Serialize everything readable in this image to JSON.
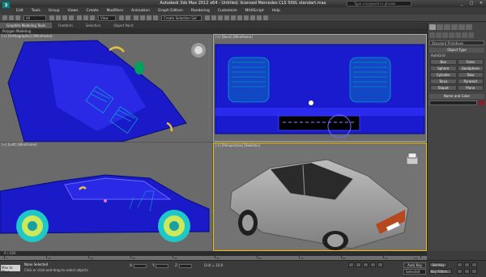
{
  "app": {
    "logo_text": "3",
    "title": "Autodesk 3ds Max 2012 x64  -  Untitled, licensed   Mercedes CLS 500L standart.max",
    "search_placeholder": "Type a keyword or phrase",
    "win_buttons": [
      "_",
      "□",
      "✕"
    ]
  },
  "menu": [
    "Edit",
    "Tools",
    "Group",
    "Views",
    "Create",
    "Modifiers",
    "Animation",
    "Graph Editors",
    "Rendering",
    "Customize",
    "MAXScript",
    "Help"
  ],
  "toolbar": {
    "selection_filter": "All",
    "view_select": "View",
    "named_selection": "Create Selection Set"
  },
  "ribbon": {
    "tabs": [
      "Graphite Modeling Tools",
      "Freeform",
      "Selection",
      "Object Paint"
    ],
    "active_tab": 0,
    "panel_label": "Polygon Modeling"
  },
  "viewports": [
    {
      "label": "[+] [Orthographic] [Wireframe]"
    },
    {
      "label": "[+] [Back] [Wireframe]"
    },
    {
      "label": "[+] [Left] [Wireframe]"
    },
    {
      "label": "[+] [Perspective] [Realistic]"
    }
  ],
  "command_panel": {
    "dropdown": "Standard Primitives",
    "rollout_object_type": "Object Type",
    "autogrid": "AutoGrid",
    "buttons": [
      "Box",
      "Cone",
      "Sphere",
      "GeoSphere",
      "Cylinder",
      "Tube",
      "Torus",
      "Pyramid",
      "Teapot",
      "Plane"
    ],
    "rollout_name_color": "Name and Color",
    "color": "#8a1d2b"
  },
  "timeline": {
    "label": "0 / 100",
    "ticks": [
      "0",
      "10",
      "20",
      "30",
      "40",
      "50",
      "60",
      "70",
      "80",
      "90",
      "100"
    ]
  },
  "status": {
    "maxscript": "Max to Phys",
    "line1": "None Selected",
    "line2": "Click or click-and-drag to select objects",
    "x_label": "X:",
    "y_label": "Y:",
    "z_label": "Z:",
    "grid": "Grid = 10,0",
    "autokey": "Auto Key",
    "selected": "Selected",
    "setkey": "Set Key",
    "keyfilters": "Key Filters..."
  }
}
